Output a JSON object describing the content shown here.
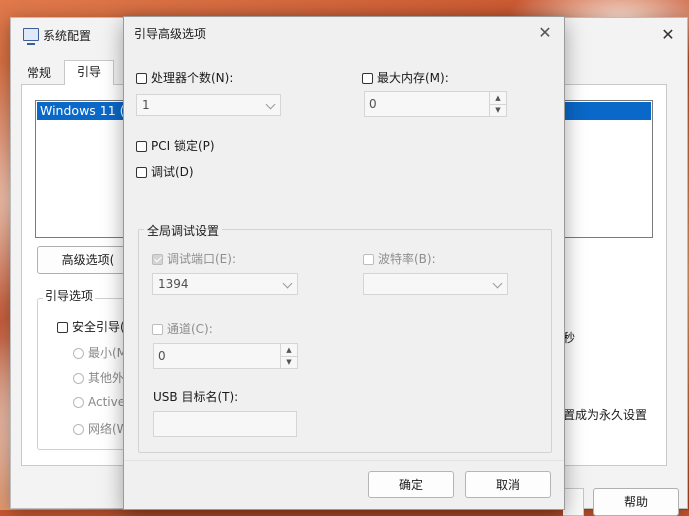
{
  "back_window": {
    "title": "系统配置",
    "tabs": [
      {
        "label": "常规"
      },
      {
        "label": "引导"
      }
    ],
    "boot_list_item": "Windows 11 (C",
    "advanced_button": "高级选项(",
    "boot_options": {
      "group_label": "引导选项",
      "safe_boot": "安全引导(",
      "minimal": "最小(M",
      "other_shell": "其他外",
      "active_dir": "Active",
      "network": "网络(W"
    },
    "seconds_fragment": "秒",
    "permanent_fragment": "置成为永久设置",
    "help_button": "帮助"
  },
  "dialog": {
    "title": "引导高级选项",
    "num_processors": {
      "label": "处理器个数(N):",
      "checked": false,
      "value": "1"
    },
    "max_memory": {
      "label": "最大内存(M):",
      "checked": false,
      "value": "0"
    },
    "pci_lock": {
      "label": "PCI 锁定(P)",
      "checked": false
    },
    "debug": {
      "label": "调试(D)",
      "checked": false
    },
    "global_debug": {
      "group_label": "全局调试设置",
      "debug_port": {
        "label": "调试端口(E):",
        "checked": true,
        "enabled": false,
        "value": "1394"
      },
      "baud_rate": {
        "label": "波特率(B):",
        "checked": false,
        "enabled": false,
        "value": ""
      },
      "channel": {
        "label": "通道(C):",
        "checked": false,
        "enabled": false,
        "value": "0"
      },
      "usb_target": {
        "label": "USB 目标名(T):",
        "value": ""
      }
    },
    "ok_button": "确定",
    "cancel_button": "取消"
  }
}
